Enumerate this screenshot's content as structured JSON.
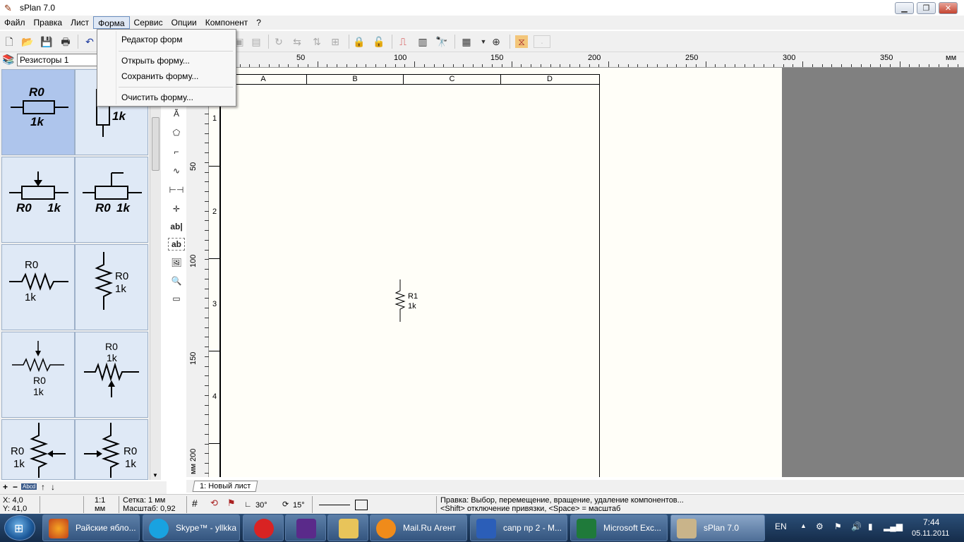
{
  "window": {
    "title": "sPlan 7.0"
  },
  "menu": [
    {
      "label": "Файл"
    },
    {
      "label": "Правка"
    },
    {
      "label": "Лист"
    },
    {
      "label": "Форма"
    },
    {
      "label": "Сервис"
    },
    {
      "label": "Опции"
    },
    {
      "label": "Компонент"
    },
    {
      "label": "?"
    }
  ],
  "dropdown": {
    "items": [
      {
        "label": "Редактор форм"
      },
      {
        "label": "Открыть форму..."
      },
      {
        "label": "Сохранить форму..."
      },
      {
        "label": "Очистить форму..."
      }
    ]
  },
  "library": {
    "selected": "Резисторы 1"
  },
  "palette": [
    {
      "label_top": "R0",
      "label_bottom": "1k"
    },
    {
      "label_top": "",
      "label_bottom": "1k"
    },
    {
      "label_top": "R0",
      "label_bottom": "1k"
    },
    {
      "label_top": "R0",
      "label_bottom": "1k"
    },
    {
      "label_top": "R0",
      "label_bottom": "1k"
    },
    {
      "label_top": "R0",
      "label_bottom": "1k"
    },
    {
      "label_top": "R0",
      "label_bottom": "1k"
    },
    {
      "label_top": "R0",
      "label_bottom": "1k"
    },
    {
      "label_top": "R0",
      "label_bottom": "1k"
    },
    {
      "label_top": "R0",
      "label_bottom": "1k"
    }
  ],
  "ruler": {
    "h_labels": [
      "50",
      "100",
      "150",
      "200",
      "250",
      "300",
      "350",
      "мм"
    ],
    "v_labels": [
      "50",
      "100",
      "150",
      "200",
      "мм"
    ]
  },
  "sheet": {
    "columns": [
      "A",
      "B",
      "C",
      "D"
    ],
    "rows": [
      "1",
      "2",
      "3",
      "4"
    ]
  },
  "component": {
    "name": "R1",
    "value": "1k"
  },
  "tabs": [
    {
      "label": "1: Новый лист"
    }
  ],
  "leftctl": {
    "plus": "+",
    "minus": "−",
    "abcd": "Abcd",
    "up": "↑",
    "down": "↓"
  },
  "status": {
    "x": "X: 4,0",
    "y": "Y: 41,0",
    "scale_ratio": "1:1",
    "scale_unit": "мм",
    "grid": "Сетка: 1 мм",
    "zoom": "Масштаб:  0,92",
    "angle1": "30°",
    "angle2": "15°",
    "hint1": "Правка: Выбор, перемещение, вращение, удаление компонентов...",
    "hint2": "<Shift> отключение привязки, <Space> = масштаб"
  },
  "taskbar": {
    "tasks": [
      {
        "label": "Райские ябло..."
      },
      {
        "label": "Skype™ - yllkka"
      },
      {
        "label": ""
      },
      {
        "label": ""
      },
      {
        "label": ""
      },
      {
        "label": "Mail.Ru Агент"
      },
      {
        "label": "сапр пр 2 - M..."
      },
      {
        "label": "Microsoft Exc..."
      },
      {
        "label": "sPlan 7.0"
      }
    ],
    "lang": "EN",
    "time": "7:44",
    "date": "05.11.2011"
  },
  "colors": {
    "accent": "#aec5ec",
    "canvas": "#fffef8",
    "workspace": "#808080"
  }
}
